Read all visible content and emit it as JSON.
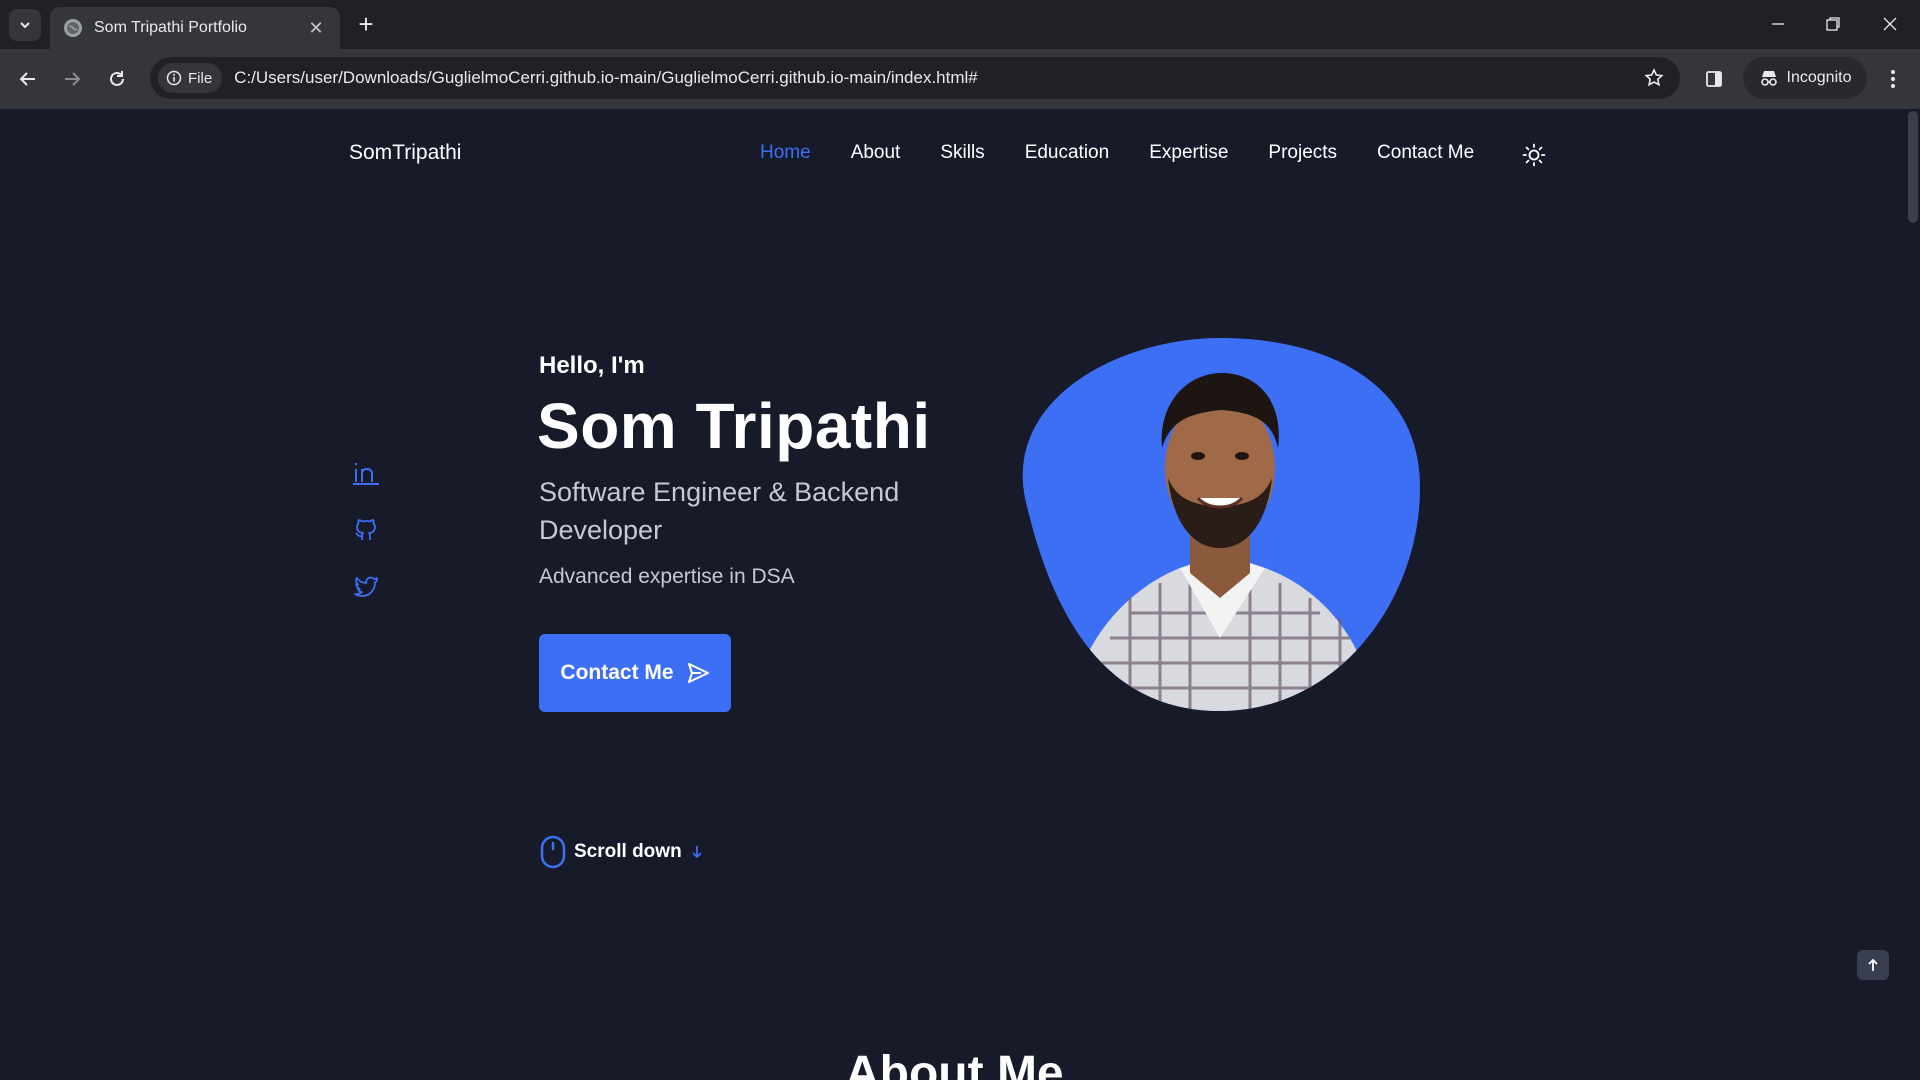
{
  "browser": {
    "tab_title": "Som Tripathi Portfolio",
    "site_chip_label": "File",
    "url": "C:/Users/user/Downloads/GuglielmoCerri.github.io-main/GuglielmoCerri.github.io-main/index.html#",
    "incognito_label": "Incognito"
  },
  "header": {
    "logo": "SomTripathi",
    "nav": [
      {
        "label": "Home",
        "active": true
      },
      {
        "label": "About"
      },
      {
        "label": "Skills"
      },
      {
        "label": "Education"
      },
      {
        "label": "Expertise"
      },
      {
        "label": "Projects"
      },
      {
        "label": "Contact Me"
      }
    ]
  },
  "social": [
    "linkedin-icon",
    "github-icon",
    "twitter-icon"
  ],
  "hero": {
    "greeting": "Hello, I'm",
    "name": "Som Tripathi",
    "role": "Software Engineer & Backend Developer",
    "description": "Advanced expertise in DSA",
    "cta_label": "Contact Me"
  },
  "scroll": {
    "label": "Scroll down"
  },
  "next_section": {
    "title": "About Me"
  },
  "colors": {
    "accent": "#3d6ff5",
    "background": "#161a29",
    "text": "#ffffff",
    "muted_text": "#c8c9d0"
  }
}
